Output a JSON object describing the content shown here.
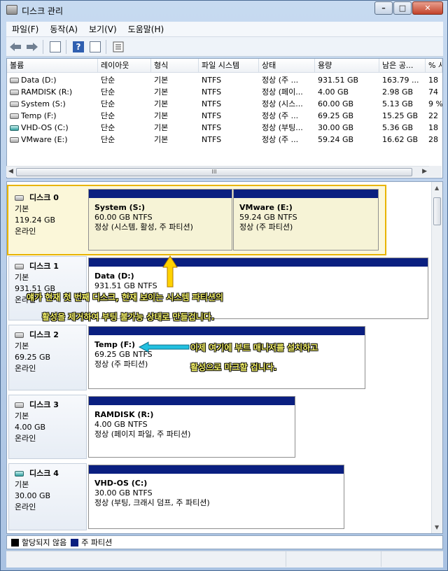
{
  "window": {
    "title": "디스크 관리",
    "min": "–",
    "max": "□",
    "close": "✕"
  },
  "menu": [
    "파일(F)",
    "동작(A)",
    "보기(V)",
    "도움말(H)"
  ],
  "toolbar": {
    "help_glyph": "?"
  },
  "columns": [
    "볼륨",
    "레이아웃",
    "형식",
    "파일 시스템",
    "상태",
    "용량",
    "남은 공...",
    "% 사용 가능"
  ],
  "volumes": [
    {
      "icon": "drive-icon",
      "name": "Data (D:)",
      "layout": "단순",
      "type": "기본",
      "fs": "NTFS",
      "status": "정상 (주 ...",
      "capacity": "931.51 GB",
      "free": "163.79 ...",
      "pct": "18"
    },
    {
      "icon": "drive-icon",
      "name": "RAMDISK (R:)",
      "layout": "단순",
      "type": "기본",
      "fs": "NTFS",
      "status": "정상 (페이...",
      "capacity": "4.00 GB",
      "free": "2.98 GB",
      "pct": "74"
    },
    {
      "icon": "drive-icon",
      "name": "System (S:)",
      "layout": "단순",
      "type": "기본",
      "fs": "NTFS",
      "status": "정상 (시스...",
      "capacity": "60.00 GB",
      "free": "5.13 GB",
      "pct": "9 %"
    },
    {
      "icon": "drive-icon",
      "name": "Temp (F:)",
      "layout": "단순",
      "type": "기본",
      "fs": "NTFS",
      "status": "정상 (주 ...",
      "capacity": "69.25 GB",
      "free": "15.25 GB",
      "pct": "22"
    },
    {
      "icon": "vhd-drive-icon",
      "name": "VHD-OS (C:)",
      "layout": "단순",
      "type": "기본",
      "fs": "NTFS",
      "status": "정상 (부팅...",
      "capacity": "30.00 GB",
      "free": "5.36 GB",
      "pct": "18"
    },
    {
      "icon": "drive-icon",
      "name": "VMware (E:)",
      "layout": "단순",
      "type": "기본",
      "fs": "NTFS",
      "status": "정상 (주 ...",
      "capacity": "59.24 GB",
      "free": "16.62 GB",
      "pct": "28"
    }
  ],
  "hscroll_grip": "III",
  "disks": [
    {
      "name": "디스크 0",
      "kind": "기본",
      "size": "119.24 GB",
      "state": "온라인",
      "partitions": [
        {
          "name": "System  (S:)",
          "size": "60.00 GB NTFS",
          "status": "정상 (시스템, 활성, 주 파티션)"
        },
        {
          "name": "VMware  (E:)",
          "size": "59.24 GB NTFS",
          "status": "정상 (주 파티션)"
        }
      ]
    },
    {
      "name": "디스크 1",
      "kind": "기본",
      "size": "931.51 GB",
      "state": "온라인",
      "partitions": [
        {
          "name": "Data  (D:)",
          "size": "931.51 GB NTFS",
          "status": ""
        }
      ]
    },
    {
      "name": "디스크 2",
      "kind": "기본",
      "size": "69.25 GB",
      "state": "온라인",
      "partitions": [
        {
          "name": "Temp  (F:)",
          "size": "69.25 GB NTFS",
          "status": "정상 (주 파티션)"
        }
      ]
    },
    {
      "name": "디스크 3",
      "kind": "기본",
      "size": "4.00 GB",
      "state": "온라인",
      "partitions": [
        {
          "name": "RAMDISK  (R:)",
          "size": "4.00 GB NTFS",
          "status": "정상 (페이지 파일, 주 파티션)"
        }
      ]
    },
    {
      "name": "디스크 4",
      "kind": "기본",
      "size": "30.00 GB",
      "state": "온라인",
      "partitions": [
        {
          "name": "VHD-OS  (C:)",
          "size": "30.00 GB NTFS",
          "status": "정상 (부팅, 크래시 덤프, 주 파티션)"
        }
      ]
    }
  ],
  "annotations": {
    "note1_line1": "얘가 현재 첫 번째 디스크, 현재 보이는 시스템 파티션의",
    "note1_line2": "활성을 제거하여 부팅 불가능 상태로 만들겁니다.",
    "note2_line1": "이제 여기에 부트 매니저를 설치하고",
    "note2_line2": "활성으로 마크할 겁니다.",
    "arrow_color": "#ffd200",
    "arrow2_color": "#22c0e0"
  },
  "legend": [
    {
      "label": "할당되지 않음",
      "color": "#000000"
    },
    {
      "label": "주 파티션",
      "color": "#0a1f80"
    }
  ],
  "colors": {
    "partition_header": "#0a1f80",
    "selection": "#e8b400"
  }
}
